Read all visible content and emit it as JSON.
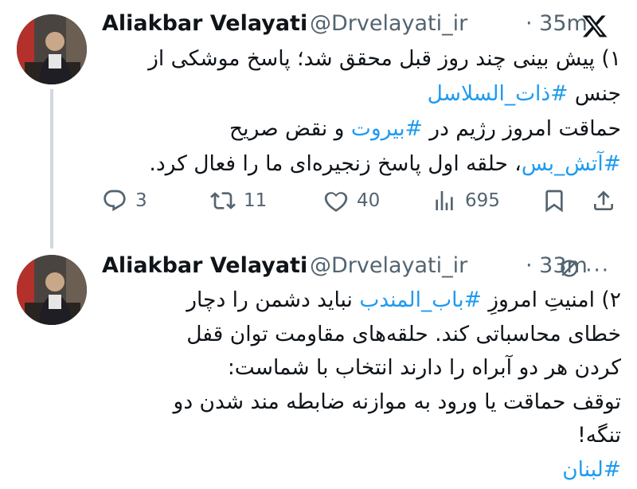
{
  "tweets": [
    {
      "author_name": "Aliakbar Velayati",
      "handle": "@Drvelayati_ir",
      "time": "· 35m",
      "lines": [
        {
          "text": "۱) پیش بینی چند روز قبل محقق شد؛ پاسخ موشکی از"
        },
        {
          "text_pre": "جنس ",
          "hashtag": "#ذات_السلاسل"
        },
        {
          "text_pre": "حماقت امروز رژیم در ",
          "hashtag": "#بیروت",
          "text_post": " و نقض صریح"
        },
        {
          "hashtag": "#آتش_بس",
          "text_post": "، حلقه اول پاسخ زنجیره‌ای ما را فعال کرد."
        }
      ],
      "stats": {
        "replies": "3",
        "reposts": "11",
        "likes": "40",
        "views": "695"
      }
    },
    {
      "author_name": "Aliakbar Velayati",
      "handle": "@Drvelayati_ir",
      "time": "· 33m",
      "more": "···",
      "lines": [
        {
          "text_pre": "۲) امنیتِ امروزِ ",
          "hashtag": "#باب_المندب",
          "text_post": " نباید دشمن را دچار"
        },
        {
          "text": "خطای محاسباتی کند. حلقه‌های مقاومت توان قفل"
        },
        {
          "text": "کردن هر دو آبراه را دارند انتخاب با شماست:"
        },
        {
          "text": "توقف حماقت یا ورود به موازنه ضابطه مند شدن دو"
        },
        {
          "text": "تنگه!"
        },
        {
          "hashtag": "#لبنان"
        }
      ]
    }
  ],
  "icons": {
    "logo": "x-logo-icon",
    "reply": "reply-icon",
    "repost": "repost-icon",
    "like": "heart-icon",
    "views": "views-icon",
    "bookmark": "bookmark-icon",
    "share": "share-icon",
    "grok": "grok-icon",
    "more": "more-icon"
  },
  "colors": {
    "text": "#0f1419",
    "muted": "#536471",
    "link": "#1d9bf0",
    "thread_line": "#cfd9de"
  }
}
